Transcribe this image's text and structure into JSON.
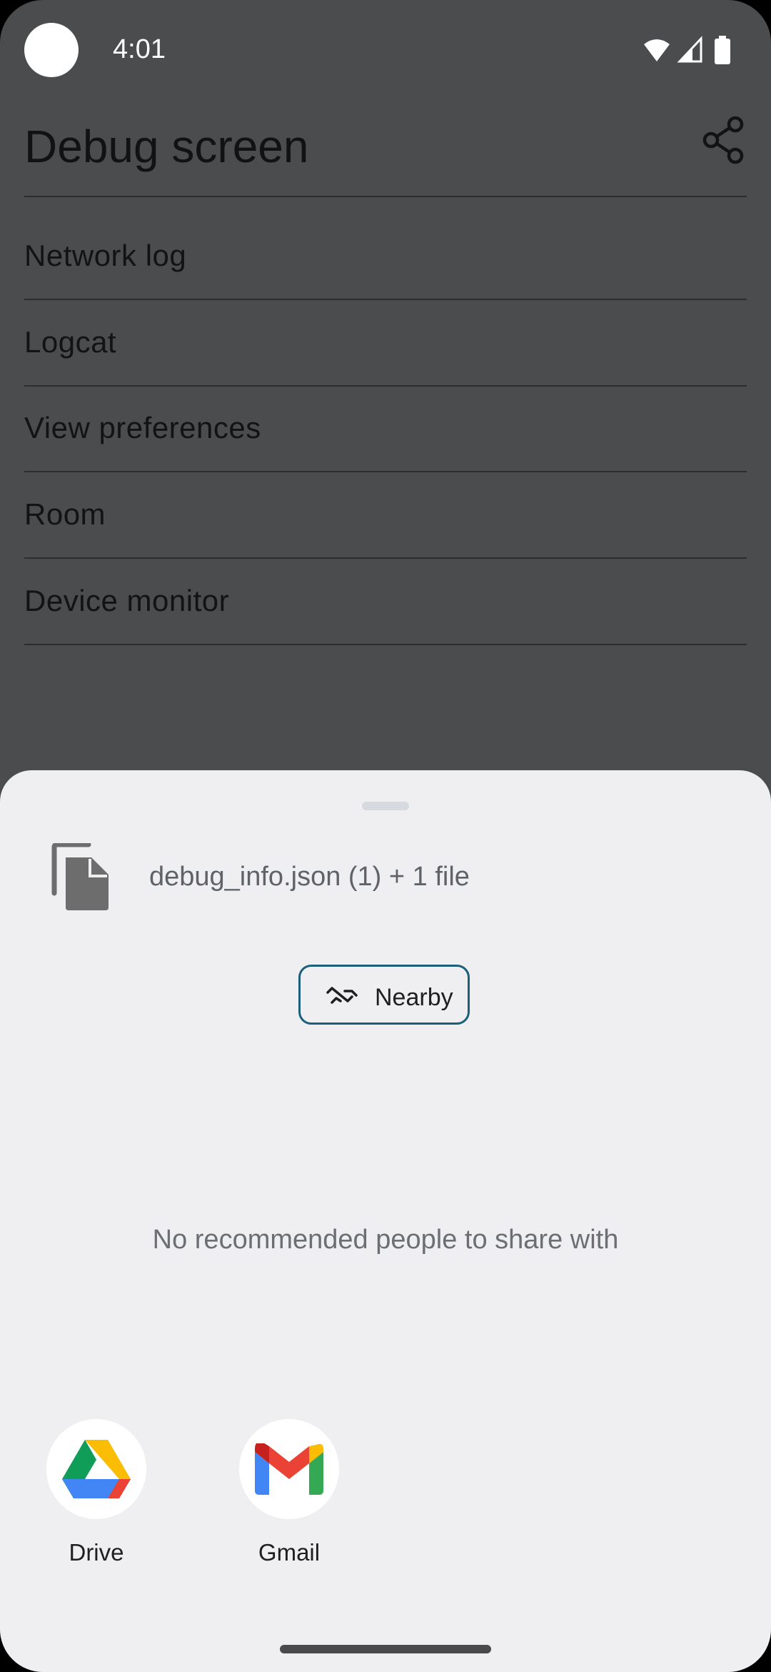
{
  "status_bar": {
    "time": "4:01",
    "icons": [
      "wifi-icon",
      "signal-icon",
      "battery-icon"
    ]
  },
  "app_bar": {
    "title": "Debug screen",
    "share_icon": "share-icon"
  },
  "menu": {
    "items": [
      {
        "label": "Network log"
      },
      {
        "label": "Logcat"
      },
      {
        "label": "View preferences"
      },
      {
        "label": "Room"
      },
      {
        "label": "Device monitor"
      }
    ]
  },
  "share_sheet": {
    "file_icon": "file-copy-icon",
    "file_summary": "debug_info.json (1) + 1 file",
    "nearby_label": "Nearby",
    "nearby_icon": "nearby-share-icon",
    "empty_people_text": "No recommended people to share with",
    "apps": [
      {
        "label": "Drive",
        "icon": "google-drive-icon"
      },
      {
        "label": "Gmail",
        "icon": "gmail-icon"
      }
    ]
  },
  "colors": {
    "scrim_background": "#4b4c4e",
    "sheet_background": "#efeff2",
    "nearby_outline": "#1c5f7a"
  }
}
